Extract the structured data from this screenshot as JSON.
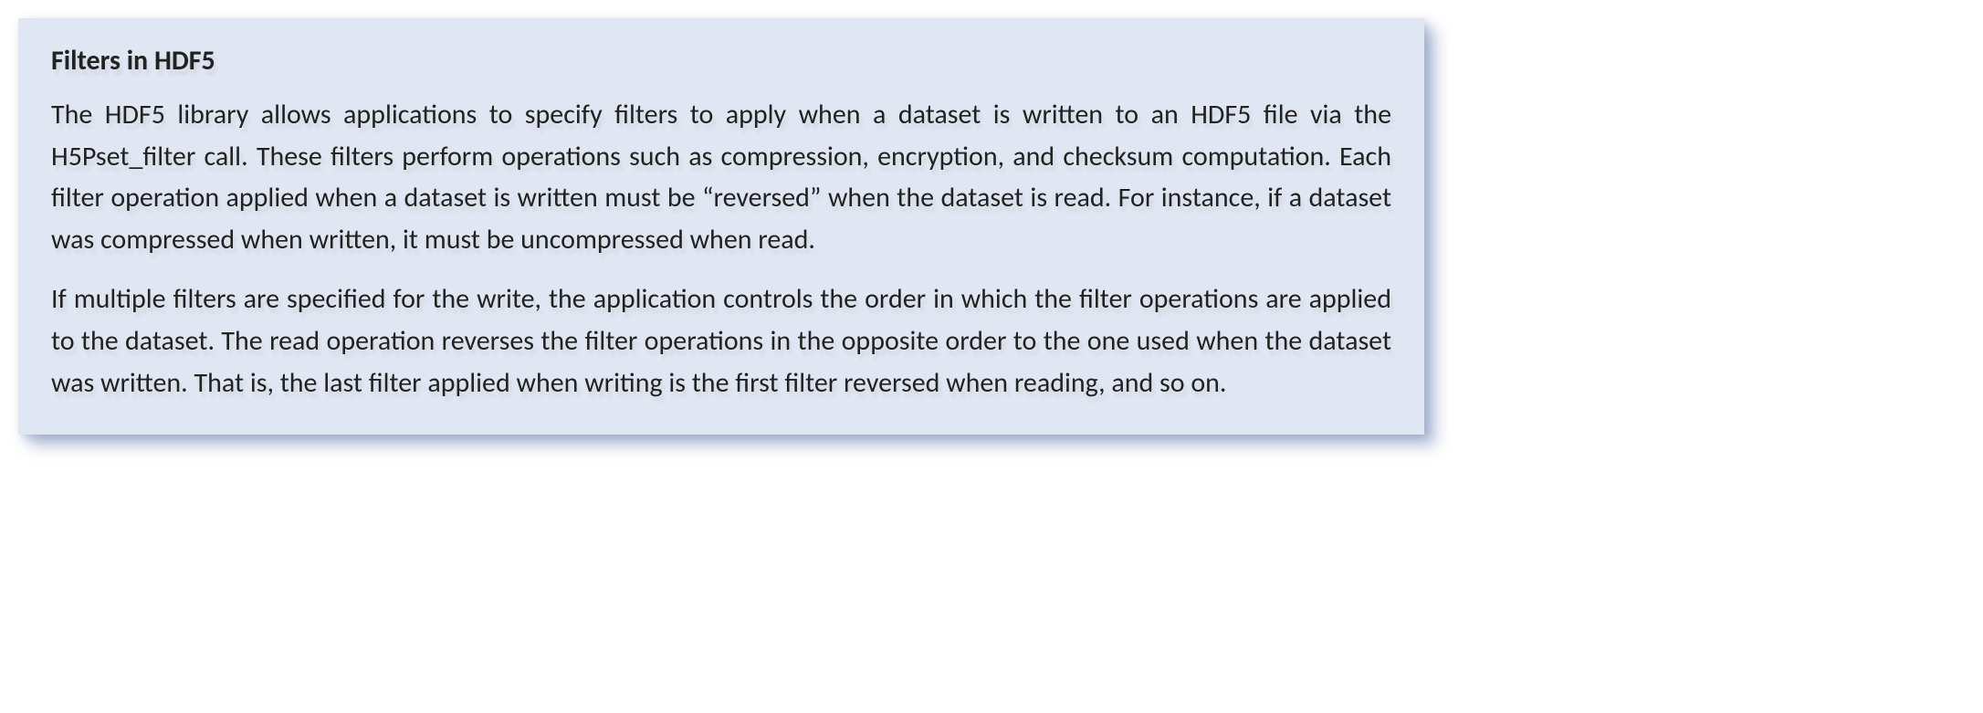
{
  "callout": {
    "heading": "Filters in HDF5",
    "paragraph1": "The HDF5 library allows applications to specify filters to apply when a dataset is written to an HDF5 file via the H5Pset_filter call. These filters perform operations such as compression, encryption, and checksum computation. Each filter operation applied when a dataset is written must be “reversed” when the dataset is read. For instance, if a dataset was compressed when written, it must be uncompressed when read.",
    "paragraph2": "If multiple filters are specified for the write, the application controls the order in which the filter operations are applied to the dataset. The read operation reverses the filter operations in the opposite order to the one used when the dataset was written. That is, the last filter applied when writing is the first filter reversed when reading, and so on."
  }
}
